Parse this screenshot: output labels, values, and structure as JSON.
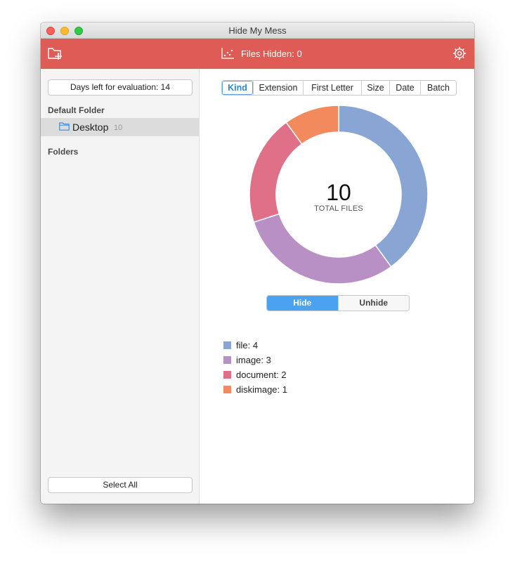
{
  "window": {
    "title": "Hide My Mess"
  },
  "toolbar": {
    "add_folder_icon": "folder-plus-icon",
    "status_icon": "scatter-chart-icon",
    "status_text": "Files Hidden: 0",
    "settings_icon": "gear-icon",
    "color": "#df5b55"
  },
  "sidebar": {
    "evaluation_button": "Days left for evaluation: 14",
    "default_folder_heading": "Default Folder",
    "default_folder": {
      "name": "Desktop",
      "count": "10",
      "icon": "folder-icon"
    },
    "folders_heading": "Folders",
    "select_all_button": "Select All"
  },
  "main": {
    "group_tabs": [
      {
        "label": "Kind",
        "active": true
      },
      {
        "label": "Extension",
        "active": false
      },
      {
        "label": "First Letter",
        "active": false
      },
      {
        "label": "Size",
        "active": false
      },
      {
        "label": "Date",
        "active": false
      },
      {
        "label": "Batch",
        "active": false
      }
    ],
    "total_count": "10",
    "total_label": "TOTAL FILES",
    "toggle": {
      "hide_label": "Hide",
      "unhide_label": "Unhide",
      "selected": "Hide"
    },
    "legend": [
      {
        "label": "file: 4",
        "color": "#89a5d3"
      },
      {
        "label": "image: 3",
        "color": "#b990c6"
      },
      {
        "label": "document: 2",
        "color": "#e07087"
      },
      {
        "label": "diskimage: 1",
        "color": "#f28a5d"
      }
    ]
  },
  "chart_data": {
    "type": "pie",
    "donut": true,
    "categories": [
      "file",
      "image",
      "document",
      "diskimage"
    ],
    "values": [
      4,
      3,
      2,
      1
    ],
    "colors": [
      "#89a5d3",
      "#b990c6",
      "#e07087",
      "#f28a5d"
    ],
    "center_text": "10",
    "center_subtext": "TOTAL FILES"
  }
}
